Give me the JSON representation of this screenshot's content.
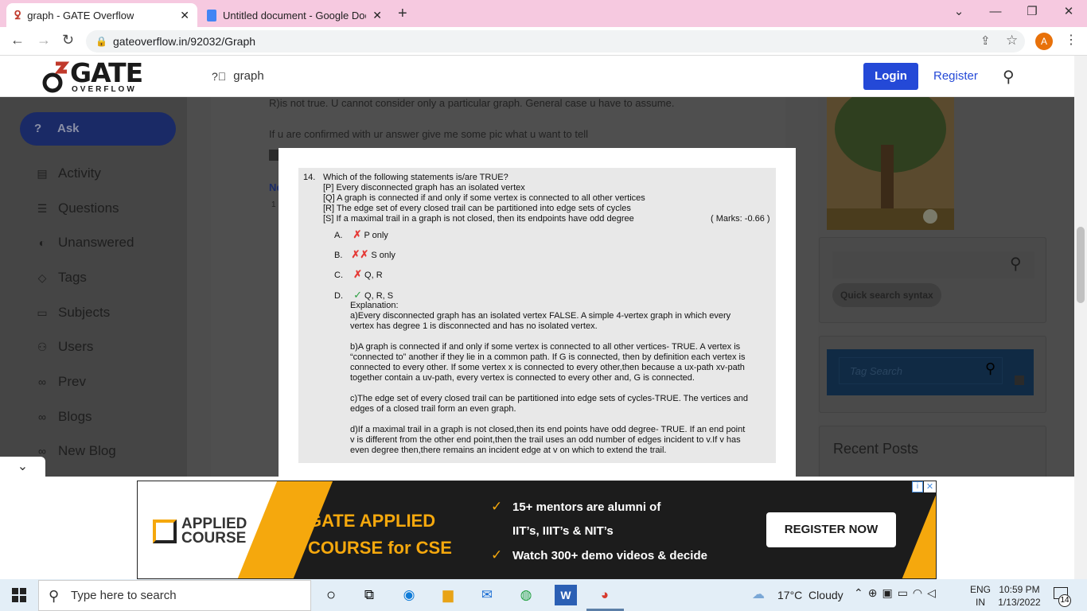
{
  "browser": {
    "tabs": [
      {
        "title": "graph - GATE Overflow",
        "active": true
      },
      {
        "title": "Untitled document - Google Doc",
        "active": false
      }
    ],
    "url": "gateoverflow.in/92032/Graph",
    "profile_initial": "A"
  },
  "site": {
    "logo_big": "GATE",
    "logo_small": "OVERFLOW",
    "breadcrumb": "graph",
    "login_label": "Login",
    "register_label": "Register"
  },
  "sidebar": {
    "ask_label": "Ask",
    "items": [
      "Activity",
      "Questions",
      "Unanswered",
      "Tags",
      "Subjects",
      "Users",
      "Prev",
      "Blogs",
      "New Blog"
    ]
  },
  "page": {
    "comment_line1": "R)is not true. U cannot consider only a particular graph. General case u have to assume.",
    "comment_line2": "If u are confirmed with ur answer give me some pic what u want to tell",
    "partial_n": "Ne",
    "partial_1": "1"
  },
  "right": {
    "quick_search_label": "Quick search syntax",
    "tag_search_placeholder": "Tag Search",
    "recent_posts": "Recent Posts"
  },
  "question": {
    "number": "14.",
    "stem": "Which of the following statements is/are TRUE?",
    "statements": [
      "[P] Every disconnected graph has an isolated vertex",
      "[Q] A graph is connected if and only if some vertex is connected to all other vertices",
      "[R] The edge set of every closed trail can be partitioned into edge sets of cycles",
      "[S] If a maximal trail in a graph is not closed, then its endpoints have odd degree"
    ],
    "marks": "( Marks: -0.66 )",
    "options": [
      {
        "letter": "A.",
        "text": "P only"
      },
      {
        "letter": "B.",
        "text": "S only"
      },
      {
        "letter": "C.",
        "text": "Q, R"
      },
      {
        "letter": "D.",
        "text": "Q, R, S"
      }
    ],
    "explanation_label": "Explanation:",
    "explanation": [
      [
        "a)Every disconnected graph has an isolated vertex FALSE. A simple 4-vertex graph in which every",
        "vertex has degree 1 is disconnected and has no isolated vertex."
      ],
      [
        "b)A graph is connected if and only if some vertex is connected to all other vertices- TRUE. A vertex is",
        "“connected to” another if they lie in a common path. If G is connected, then by definition each vertex is",
        "connected to every other. If some vertex x is connected to every other,then because a ux-path xv-path",
        "together contain a uv-path, every vertex is connected to every other and, G is connected."
      ],
      [
        "c)The edge set of every closed trail can be partitioned into edge sets of cycles-TRUE. The vertices and",
        "edges of a closed trail form an even graph."
      ],
      [
        "d)If a maximal trail in a graph is not closed,then its end points have odd degree- TRUE. If an end point",
        "v is different from the other end point,then the trail uses an odd number of edges incident to v.If v has",
        "even degree then,there remains an incident edge at v on which to extend the trail."
      ]
    ]
  },
  "ad": {
    "brand_line1": "APPLIED",
    "brand_line2": "COURSE",
    "headline1": "GATE APPLIED",
    "headline2": "COURSE for CSE",
    "bullet1": "15+ mentors are alumni of",
    "bullet1b": "IIT’s, IIIT’s & NIT’s",
    "bullet2": "Watch 300+ demo videos & decide",
    "cta": "REGISTER NOW",
    "accent": "#f5a80d"
  },
  "taskbar": {
    "search_placeholder": "Type here to search",
    "weather": "17°C  Cloudy",
    "lang1": "ENG",
    "lang2": "IN",
    "time": "10:59 PM",
    "date": "1/13/2022",
    "notif_count": "14"
  }
}
